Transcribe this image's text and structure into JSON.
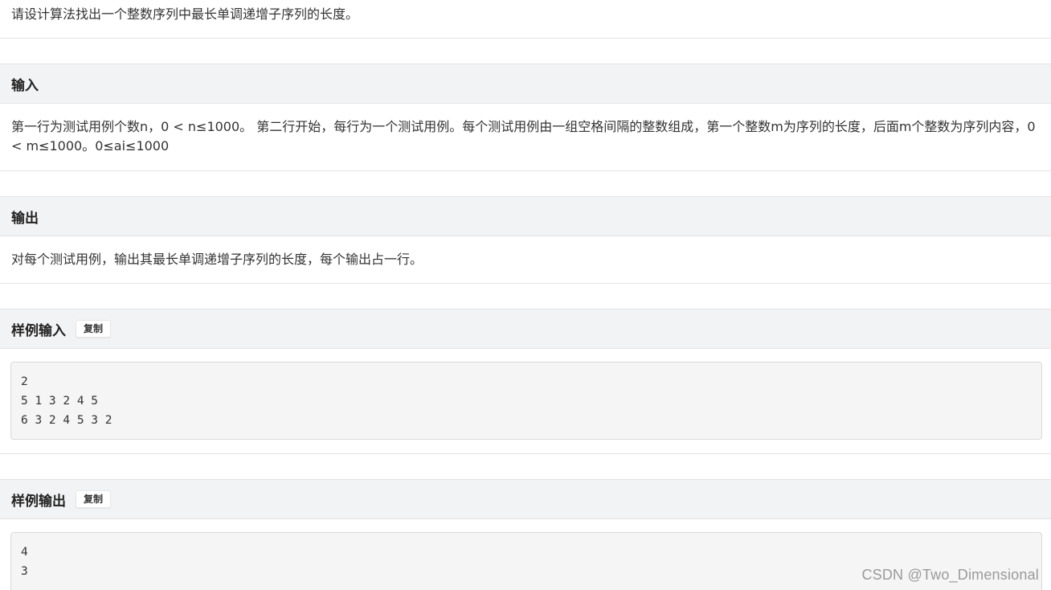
{
  "description": {
    "text": "请设计算法找出一个整数序列中最长单调递增子序列的长度。"
  },
  "input_section": {
    "title": "输入",
    "text": "第一行为测试用例个数n，0 < n≤1000。 第二行开始，每行为一个测试用例。每个测试用例由一组空格间隔的整数组成，第一个整数m为序列的长度，后面m个整数为序列内容，0 < m≤1000。0≤ai≤1000"
  },
  "output_section": {
    "title": "输出",
    "text": "对每个测试用例，输出其最长单调递增子序列的长度，每个输出占一行。"
  },
  "sample_input": {
    "title": "样例输入",
    "copy_label": "复制",
    "lines": "2\n5 1 3 2 4 5\n6 3 2 4 5 3 2"
  },
  "sample_output": {
    "title": "样例输出",
    "copy_label": "复制",
    "lines": "4\n3"
  },
  "watermark": {
    "text": "CSDN @Two_Dimensional"
  }
}
